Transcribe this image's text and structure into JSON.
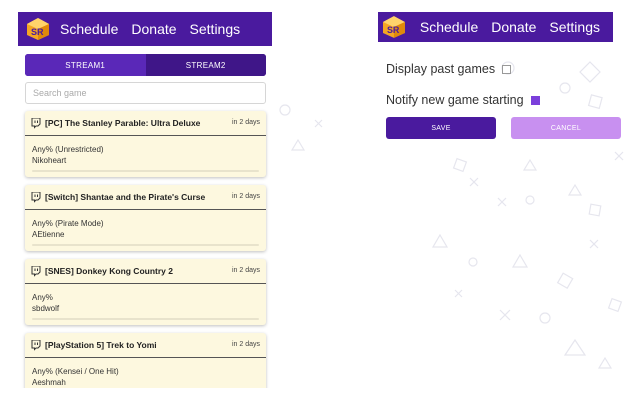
{
  "app": {
    "nav": {
      "schedule": "Schedule",
      "donate": "Donate",
      "settings": "Settings"
    },
    "brand_color": "#4a1a9e"
  },
  "schedule_panel": {
    "stream_tabs": [
      "STREAM1",
      "STREAM2"
    ],
    "active_tab": "STREAM1",
    "search_placeholder": "Search game",
    "games": [
      {
        "platform_title": "[PC] The Stanley Parable: Ultra Deluxe",
        "when": "in 2 days",
        "category": "Any% (Unrestricted)",
        "runner": "Nikoheart"
      },
      {
        "platform_title": "[Switch] Shantae and the Pirate's Curse",
        "when": "in 2 days",
        "category": "Any% (Pirate Mode)",
        "runner": "AEtienne"
      },
      {
        "platform_title": "[SNES] Donkey Kong Country 2",
        "when": "in 2 days",
        "category": "Any%",
        "runner": "sbdwolf"
      },
      {
        "platform_title": "[PlayStation 5] Trek to Yomi",
        "when": "in 2 days",
        "category": "Any% (Kensei / One Hit)",
        "runner": "Aeshmah"
      }
    ]
  },
  "settings_panel": {
    "display_past_games": {
      "label": "Display past games",
      "checked": false
    },
    "notify_new_game": {
      "label": "Notify new game starting",
      "checked": true
    },
    "save_label": "SAVE",
    "cancel_label": "CANCEL"
  }
}
